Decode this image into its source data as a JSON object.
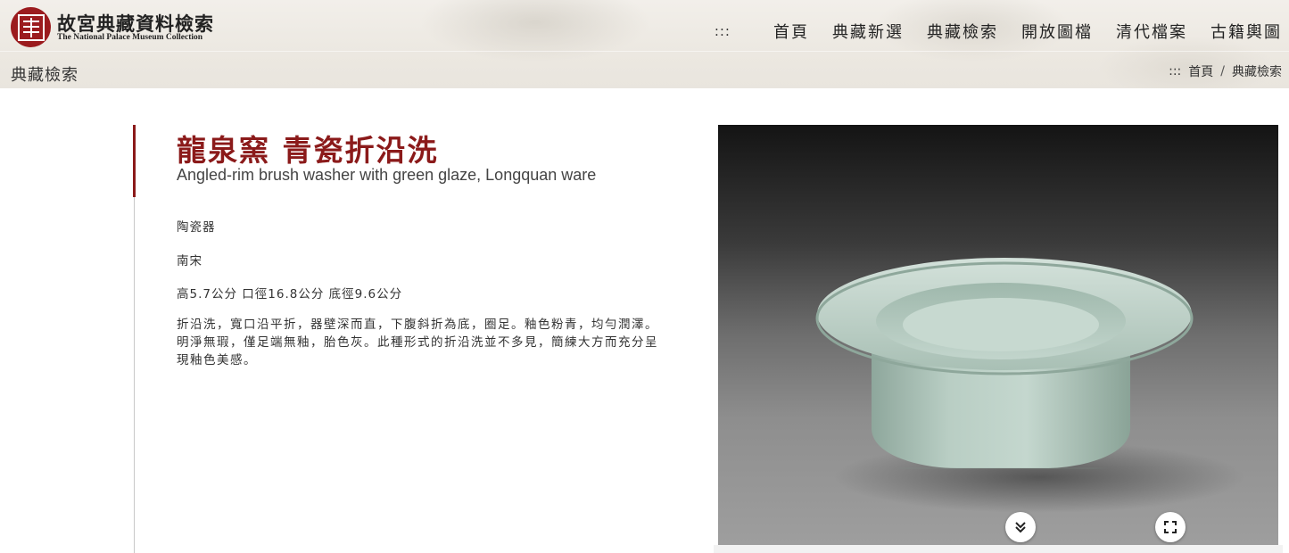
{
  "header": {
    "brand_zh": "故宮典藏資料檢索",
    "brand_en": "The National Palace Museum Collection",
    "nav_menu_icon": ":::",
    "nav_items": [
      "首頁",
      "典藏新選",
      "典藏檢索",
      "開放圖檔",
      "清代檔案",
      "古籍輿圖"
    ]
  },
  "subheader": {
    "section_title": "典藏檢索",
    "breadcrumb_icon": ":::",
    "breadcrumb": [
      "首頁",
      "典藏檢索"
    ],
    "breadcrumb_separator": "/"
  },
  "artifact": {
    "title_zh": "龍泉窯 青瓷折沿洗",
    "title_en": "Angled-rim brush washer with green glaze, Longquan ware",
    "category": "陶瓷器",
    "period": "南宋",
    "dimensions": "高5.7公分 口徑16.8公分 底徑9.6公分",
    "description": "折沿洗，寬口沿平折，器壁深而直，下腹斜折為底，圈足。釉色粉青，均勻潤澤。明淨無瑕，僅足端無釉，胎色灰。此種形式的折沿洗並不多見，簡練大方而充分呈現釉色美感。"
  },
  "viewer": {
    "scroll_down_icon": "chevron-double-down-icon",
    "fullscreen_icon": "fullscreen-icon"
  },
  "colors": {
    "accent": "#8b1a1a",
    "seal": "#9b1b1e",
    "celadon": "#b6cbc1"
  }
}
